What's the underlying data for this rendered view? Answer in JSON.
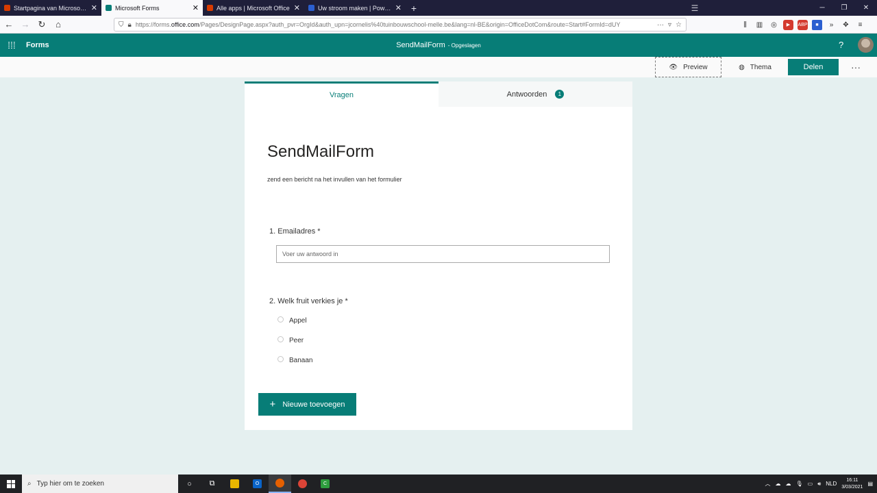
{
  "browser": {
    "tabs": [
      {
        "title": "Startpagina van Microsoft Office",
        "active": false,
        "favicon_color": "#d83b01"
      },
      {
        "title": "Microsoft Forms",
        "active": true,
        "favicon_color": "#077d77"
      },
      {
        "title": "Alle apps | Microsoft Office",
        "active": false,
        "favicon_color": "#d83b01"
      },
      {
        "title": "Uw stroom maken | Power Automate",
        "active": false,
        "favicon_color": "#2b5fd0"
      }
    ],
    "new_tab": "+",
    "url": {
      "prefix": "https://forms.",
      "domain": "office.com",
      "path": "/Pages/DesignPage.aspx?auth_pvr=OrgId&auth_upn=jcornelis%40tuinbouwschool-melle.be&lang=nl-BE&origin=OfficeDotCom&route=Start#FormId=dUY"
    }
  },
  "app": {
    "name": "Forms",
    "doc_title": "SendMailForm",
    "save_status": "- Opgeslagen",
    "help": "?",
    "accent_color": "#077d77"
  },
  "commands": {
    "preview": "Preview",
    "thema": "Thema",
    "delen": "Delen",
    "more": "···"
  },
  "form": {
    "tabs": {
      "questions": "Vragen",
      "responses": "Antwoorden",
      "response_count": "1"
    },
    "title": "SendMailForm",
    "description": "zend een bericht na het invullen van het formulier",
    "q1": {
      "label": "1. Emailadres *",
      "placeholder": "Voer uw antwoord in"
    },
    "q2": {
      "label": "2. Welk fruit verkies je *",
      "options": [
        "Appel",
        "Peer",
        "Banaan"
      ]
    },
    "add_button": "Nieuwe toevoegen"
  },
  "taskbar": {
    "search_placeholder": "Typ hier om te zoeken",
    "language": "NLD",
    "time": "16:11",
    "date": "3/03/2021"
  }
}
